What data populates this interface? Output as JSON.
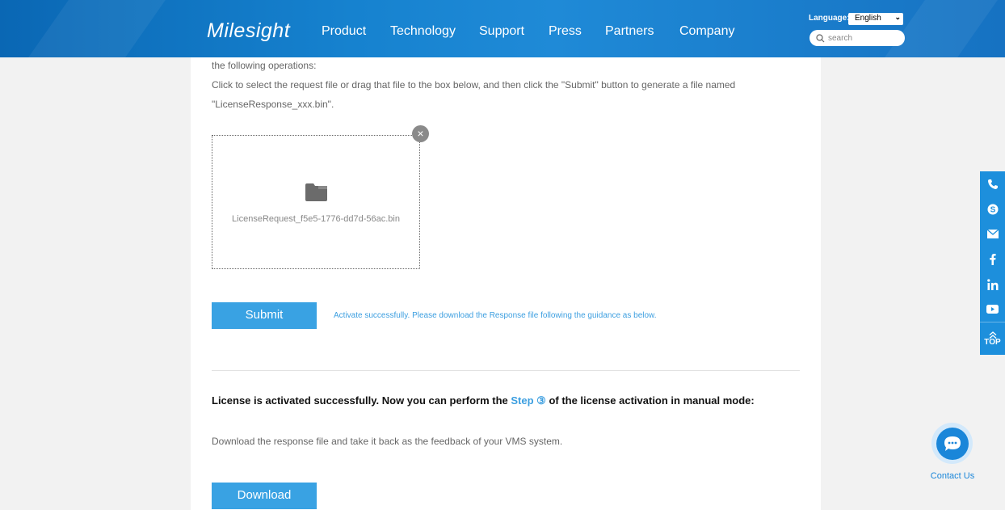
{
  "header": {
    "logo": "Milesight",
    "nav": [
      "Product",
      "Technology",
      "Support",
      "Press",
      "Partners",
      "Company"
    ],
    "language_label": "Language:",
    "language_value": "English",
    "search_placeholder": "search"
  },
  "content": {
    "intro_line1": "the following operations:",
    "intro_line2": "Click to select the request file or drag that file to the box below, and then click the \"Submit\" button to generate a file named",
    "intro_line3": "\"LicenseResponse_xxx.bin\".",
    "file_name": "LicenseRequest_f5e5-1776-dd7d-56ac.bin",
    "close_symbol": "×",
    "submit_label": "Submit",
    "success_message": "Activate successfully. Please download the Response file following the guidance as below.",
    "heading_before": "License is activated successfully. Now you can perform the ",
    "heading_step": "Step ③",
    "heading_after": " of the license activation in manual mode:",
    "download_description": "Download the response file and take it back as the feedback of your VMS system.",
    "download_label": "Download"
  },
  "sidebar": {
    "icons": [
      "phone-icon",
      "skype-icon",
      "mail-icon",
      "facebook-icon",
      "linkedin-icon",
      "youtube-icon"
    ],
    "top_label": "TOP"
  },
  "contact": {
    "label": "Contact Us"
  },
  "colors": {
    "header_blue": "#1682cf",
    "accent_blue": "#39a2e3",
    "link_blue": "#3d9fe0"
  }
}
